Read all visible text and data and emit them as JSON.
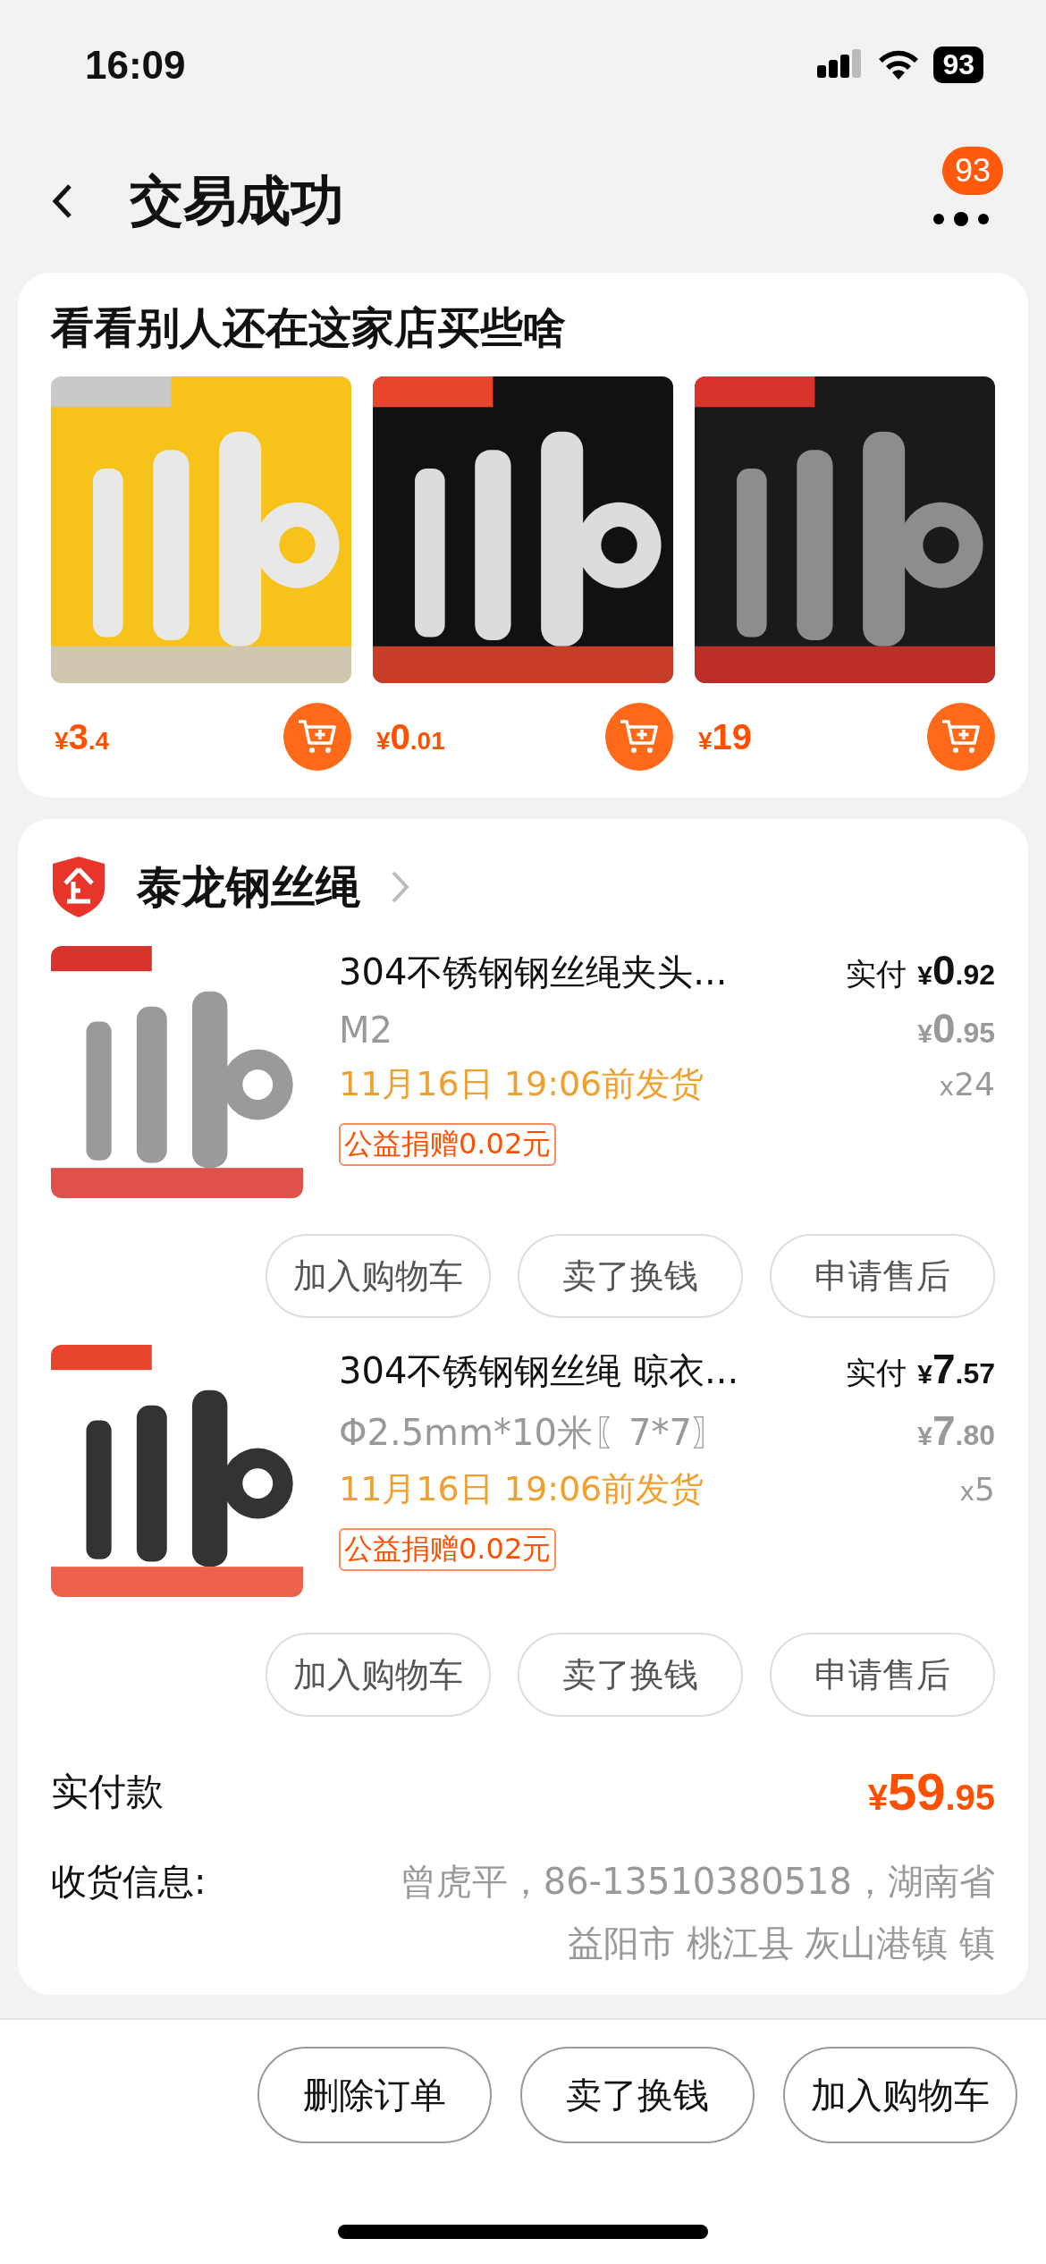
{
  "status_bar": {
    "time": "16:09",
    "battery": "93"
  },
  "nav": {
    "title": "交易成功",
    "badge": "93"
  },
  "recommend": {
    "title": "看看别人还在这家店买些啥",
    "products": [
      {
        "kind": "picture",
        "price": {
          "currency": "¥",
          "integer": "3",
          "decimal": ".4"
        }
      },
      {
        "kind": "picture",
        "price": {
          "currency": "¥",
          "integer": "0",
          "decimal": ".01"
        }
      },
      {
        "kind": "picture",
        "price": {
          "currency": "¥",
          "integer": "19"
        }
      }
    ]
  },
  "shop": {
    "name": "泰龙钢丝绳",
    "items": [
      {
        "title": "304不锈钢钢丝绳夹头...",
        "spec": "M2",
        "ship": "11月16日 19:06前发货",
        "donation": "公益捐赠0.02元",
        "paid_label": "实付",
        "paid": {
          "currency": "¥",
          "integer": "0",
          "decimal": ".92"
        },
        "original": {
          "currency": "¥",
          "integer": "0",
          "decimal": ".95"
        },
        "qty_mark": "x",
        "qty": "24",
        "buttons": [
          "加入购物车",
          "卖了换钱",
          "申请售后"
        ]
      },
      {
        "title": "304不锈钢钢丝绳 晾衣...",
        "spec": "Φ2.5mm*10米〖7*7〗",
        "ship": "11月16日 19:06前发货",
        "donation": "公益捐赠0.02元",
        "paid_label": "实付",
        "paid": {
          "currency": "¥",
          "integer": "7",
          "decimal": ".57"
        },
        "original": {
          "currency": "¥",
          "integer": "7",
          "decimal": ".80"
        },
        "qty_mark": "x",
        "qty": "5",
        "buttons": [
          "加入购物车",
          "卖了换钱",
          "申请售后"
        ]
      }
    ],
    "total_label": "实付款",
    "total": {
      "currency": "¥",
      "integer": "59",
      "decimal": ".95"
    },
    "address_label": "收货信息:",
    "address_lines": [
      "曾虎平，86-13510380518，湖南省",
      "益阳市 桃江县 灰山港镇 镇"
    ]
  },
  "bottom_buttons": [
    "删除订单",
    "卖了换钱",
    "加入购物车"
  ]
}
